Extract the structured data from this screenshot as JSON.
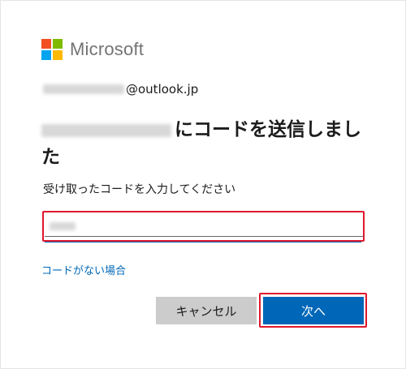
{
  "brand": {
    "name": "Microsoft",
    "colors": {
      "red": "#f25022",
      "green": "#7fba00",
      "blue": "#00a4ef",
      "yellow": "#ffb900"
    }
  },
  "email": {
    "domain": "@outlook.jp"
  },
  "heading": {
    "text": "にコードを送信しました"
  },
  "instruction": "受け取ったコードを入力してください",
  "code_input": {
    "value": "",
    "placeholder": ""
  },
  "links": {
    "no_code": "コードがない場合"
  },
  "buttons": {
    "cancel": "キャンセル",
    "next": "次へ"
  },
  "theme": {
    "primary": "#0067b8",
    "highlight": "#e0182d",
    "secondary_button": "#cccccc"
  }
}
